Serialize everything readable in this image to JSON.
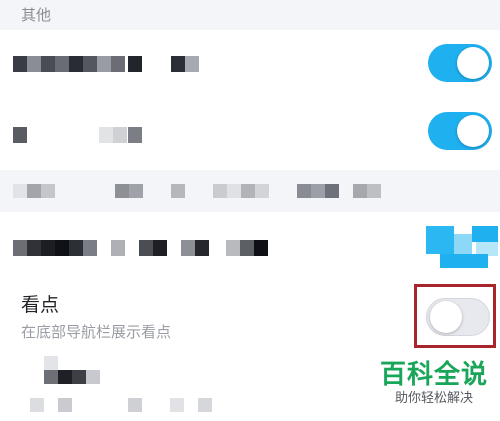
{
  "section": {
    "title": "其他"
  },
  "rows": {
    "top_toggle_1": {
      "on": true
    },
    "top_toggle_2": {
      "on": true
    },
    "kandian": {
      "label": "看点",
      "description": "在底部导航栏展示看点",
      "toggle_on": false
    }
  },
  "watermark": {
    "title": "百科全说",
    "subtitle": "助你轻松解决"
  },
  "colors": {
    "toggle_on": "#1fb0f0",
    "toggle_off": "#e8e9ee",
    "highlight": "#a8262b",
    "watermark": "#1aa65a"
  }
}
